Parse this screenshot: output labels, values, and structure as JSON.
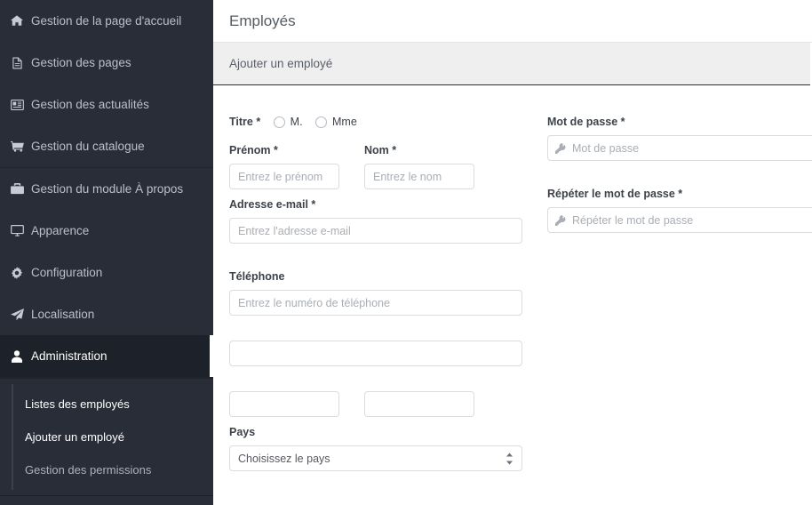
{
  "sidebar": {
    "groups": [
      {
        "items": [
          {
            "label": "Gestion de la page d'accueil",
            "icon": "home-icon",
            "name": "sidebar-item-homepage"
          },
          {
            "label": "Gestion des pages",
            "icon": "file-icon",
            "name": "sidebar-item-pages"
          },
          {
            "label": "Gestion des actualités",
            "icon": "newspaper-icon",
            "name": "sidebar-item-news"
          },
          {
            "label": "Gestion du catalogue",
            "icon": "cart-icon",
            "name": "sidebar-item-catalogue"
          }
        ]
      },
      {
        "items": [
          {
            "label": "Gestion du module À propos",
            "icon": "briefcase-icon",
            "name": "sidebar-item-about"
          },
          {
            "label": "Apparence",
            "icon": "desktop-icon",
            "name": "sidebar-item-appearance"
          },
          {
            "label": "Configuration",
            "icon": "gear-icon",
            "name": "sidebar-item-configuration"
          },
          {
            "label": "Localisation",
            "icon": "paper-plane-icon",
            "name": "sidebar-item-localisation"
          },
          {
            "label": "Administration",
            "icon": "user-icon",
            "name": "sidebar-item-administration",
            "active": true
          }
        ]
      }
    ],
    "submenu": [
      {
        "label": "Listes des employés",
        "name": "submenu-item-employee-list",
        "dim": false
      },
      {
        "label": "Ajouter un employé",
        "name": "submenu-item-add-employee",
        "dim": false
      },
      {
        "label": "Gestion des permissions",
        "name": "submenu-item-permissions",
        "dim": true
      }
    ]
  },
  "header": {
    "title": "Employés"
  },
  "panel": {
    "title": "Ajouter un employé"
  },
  "form": {
    "title_label": "Titre *",
    "title_options": [
      {
        "label": "M.",
        "name": "radio-title-mr"
      },
      {
        "label": "Mme",
        "name": "radio-title-mrs"
      }
    ],
    "firstname_label": "Prénom *",
    "firstname_placeholder": "Entrez le prénom",
    "firstname_value": "",
    "lastname_label": "Nom *",
    "lastname_placeholder": "Entrez le nom",
    "lastname_value": "",
    "email_label": "Adresse e-mail *",
    "email_placeholder": "Entrez l'adresse e-mail",
    "email_value": "",
    "phone_label": "Téléphone",
    "phone_placeholder": "Entrez le numéro de téléphone",
    "phone_value": "",
    "address_value": "",
    "address_placeholder": "",
    "city_value": "",
    "city_placeholder": "",
    "zip_value": "",
    "zip_placeholder": "",
    "country_label": "Pays",
    "country_selected": "Choisissez le pays",
    "password_label": "Mot de passe *",
    "password_placeholder": "Mot de passe",
    "password_value": "",
    "password_repeat_label": "Répéter le mot de passe *",
    "password_repeat_placeholder": "Répéter le mot de passe",
    "password_repeat_value": ""
  },
  "colors": {
    "sidebar_bg": "#282d37",
    "sidebar_active_bg": "#1d2129",
    "panel_head_bg": "#efefef",
    "text_dark": "#3d4249",
    "placeholder": "#a9aeb4",
    "border": "#dcdcdc"
  }
}
